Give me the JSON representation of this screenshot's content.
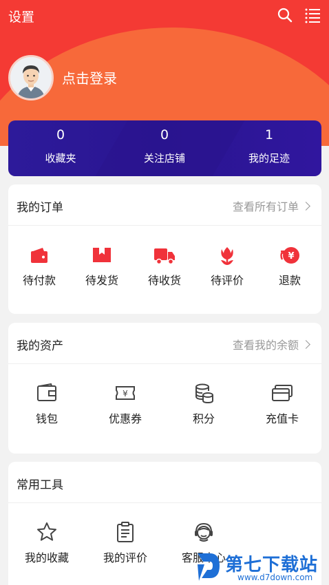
{
  "header": {
    "settings_label": "设置",
    "login_label": "点击登录"
  },
  "stats": [
    {
      "value": "0",
      "label": "收藏夹"
    },
    {
      "value": "0",
      "label": "关注店铺"
    },
    {
      "value": "1",
      "label": "我的足迹"
    }
  ],
  "orders": {
    "title": "我的订单",
    "link": "查看所有订单",
    "items": [
      {
        "label": "待付款",
        "icon": "wallet-icon"
      },
      {
        "label": "待发货",
        "icon": "box-icon"
      },
      {
        "label": "待收货",
        "icon": "truck-icon"
      },
      {
        "label": "待评价",
        "icon": "flower-icon"
      },
      {
        "label": "退款",
        "icon": "refund-yen-icon"
      }
    ]
  },
  "assets": {
    "title": "我的资产",
    "link": "查看我的余额",
    "items": [
      {
        "label": "钱包",
        "icon": "wallet-outline-icon"
      },
      {
        "label": "优惠券",
        "icon": "coupon-icon"
      },
      {
        "label": "积分",
        "icon": "coins-icon"
      },
      {
        "label": "充值卡",
        "icon": "card-icon"
      }
    ]
  },
  "tools": {
    "title": "常用工具",
    "items": [
      {
        "label": "我的收藏",
        "icon": "star-icon"
      },
      {
        "label": "我的评价",
        "icon": "clipboard-icon"
      },
      {
        "label": "客服中心",
        "icon": "customer-service-icon"
      }
    ]
  },
  "watermark": {
    "text": "第七下载站",
    "url": "www.d7down.com"
  },
  "colors": {
    "brand_red": "#f43a34",
    "stats_bg": "#2d1a9a",
    "watermark_blue": "#1e6fd6"
  }
}
